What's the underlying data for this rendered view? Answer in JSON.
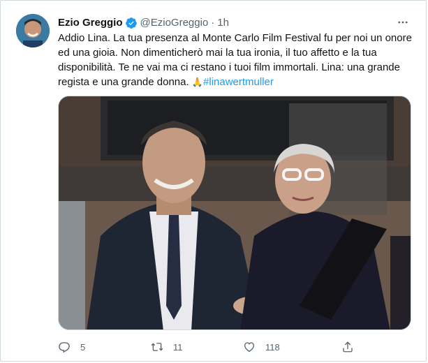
{
  "author": {
    "name": "Ezio Greggio",
    "handle": "@EzioGreggio",
    "separator": "·",
    "time": "1h"
  },
  "tweet": {
    "lines": [
      "Addio Lina. La tua presenza al Monte Carlo Film Festival fu per noi un onore",
      "ed una gioia. Non dimenticherò mai la tua ironia, il tuo affetto e la tua",
      "disponibilità. Te ne vai ma ci restano i tuoi film immortali. Lina: una grande",
      "regista e una grande donna. "
    ],
    "emoji": "🙏",
    "hashtag": "#linawertmuller"
  },
  "actions": {
    "replies": "5",
    "retweets": "11",
    "likes": "118"
  },
  "colors": {
    "accent": "#1d9bf0",
    "muted": "#536471",
    "text": "#0f1419",
    "border": "#cfd9de"
  },
  "icons": {
    "verified": "verified-badge-icon",
    "more": "more-horizontal-icon",
    "reply": "reply-icon",
    "retweet": "retweet-icon",
    "like": "heart-icon",
    "share": "share-icon"
  }
}
